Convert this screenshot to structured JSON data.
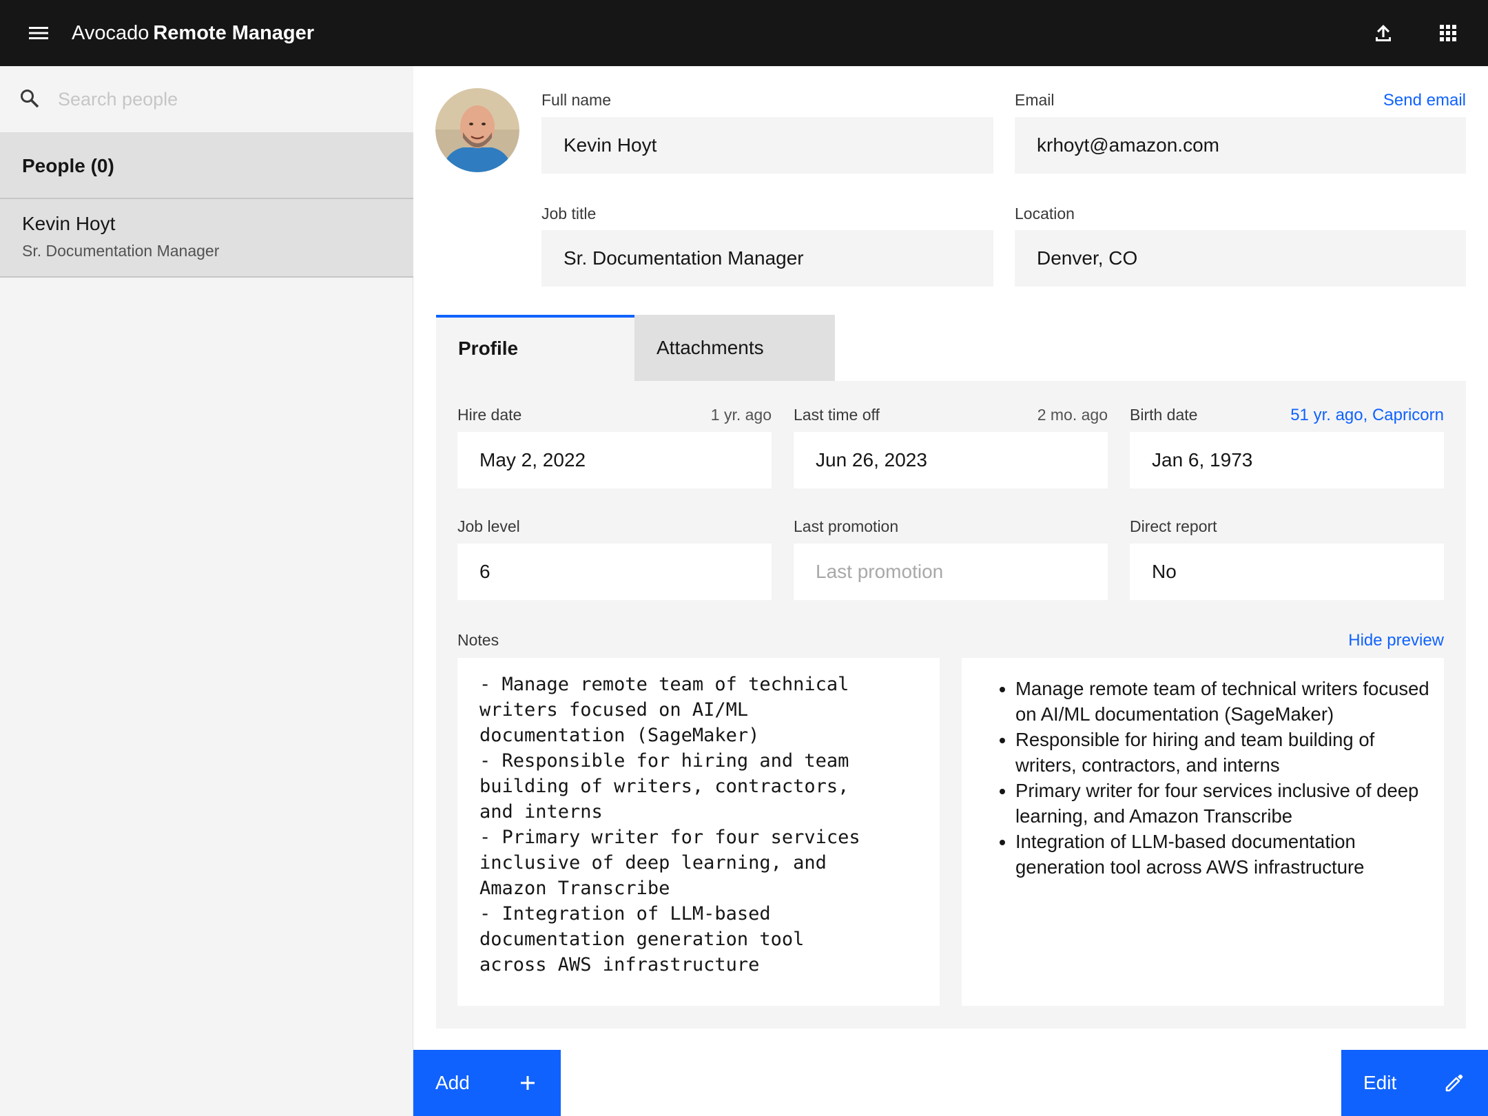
{
  "header": {
    "app_prefix": "Avocado",
    "app_name": "Remote Manager"
  },
  "sidebar": {
    "search_placeholder": "Search people",
    "people_header": "People (0)",
    "items": [
      {
        "name": "Kevin Hoyt",
        "title": "Sr. Documentation Manager"
      }
    ]
  },
  "person": {
    "full_name_label": "Full name",
    "full_name": "Kevin Hoyt",
    "email_label": "Email",
    "email": "krhoyt@amazon.com",
    "send_email": "Send email",
    "job_title_label": "Job title",
    "job_title": "Sr. Documentation Manager",
    "location_label": "Location",
    "location": "Denver, CO"
  },
  "tabs": [
    {
      "label": "Profile"
    },
    {
      "label": "Attachments"
    }
  ],
  "profile": {
    "hire_date_label": "Hire date",
    "hire_date_hint": "1 yr. ago",
    "hire_date": "May 2, 2022",
    "last_time_off_label": "Last time off",
    "last_time_off_hint": "2 mo. ago",
    "last_time_off": "Jun 26, 2023",
    "birth_date_label": "Birth date",
    "birth_date_hint": "51 yr. ago, Capricorn",
    "birth_date": "Jan 6, 1973",
    "job_level_label": "Job level",
    "job_level": "6",
    "last_promotion_label": "Last promotion",
    "last_promotion_placeholder": "Last promotion",
    "direct_report_label": "Direct report",
    "direct_report": "No",
    "notes_label": "Notes",
    "hide_preview": "Hide preview",
    "notes_raw": "- Manage remote team of technical\nwriters focused on AI/ML\ndocumentation (SageMaker)\n- Responsible for hiring and team\nbuilding of writers, contractors,\nand interns\n- Primary writer for four services\ninclusive of deep learning, and\nAmazon Transcribe\n- Integration of LLM-based\ndocumentation generation tool\nacross AWS infrastructure",
    "notes_preview": [
      "Manage remote team of technical writers focused on AI/ML documentation (SageMaker)",
      "Responsible for hiring and team building of writers, contractors, and interns",
      "Primary writer for four services inclusive of deep learning, and Amazon Transcribe",
      "Integration of LLM-based documentation generation tool across AWS infrastructure"
    ]
  },
  "actions": {
    "add_label": "Add",
    "edit_label": "Edit"
  },
  "icons": {
    "menu": "menu-icon",
    "upload": "upload-icon",
    "apps": "apps-grid-icon",
    "search": "search-icon",
    "add": "plus-icon",
    "edit": "pencil-icon"
  },
  "colors": {
    "accent": "#0f62fe",
    "header_bg": "#161616",
    "field_bg": "#f4f4f4",
    "selected_bg": "#e0e0e0"
  }
}
